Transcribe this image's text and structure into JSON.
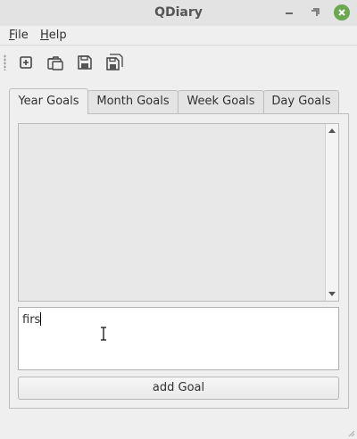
{
  "window": {
    "title": "QDiary",
    "controls": [
      "minimize-icon",
      "maximize-icon",
      "close-icon"
    ]
  },
  "menubar": {
    "items": [
      {
        "label": "File",
        "mnemonic": "F"
      },
      {
        "label": "Help",
        "mnemonic": "H"
      }
    ]
  },
  "toolbar": {
    "buttons": [
      "new-icon",
      "open-icon",
      "save-icon",
      "save-all-icon"
    ]
  },
  "tabs": [
    {
      "label": "Year Goals",
      "active": true
    },
    {
      "label": "Month Goals",
      "active": false
    },
    {
      "label": "Week Goals",
      "active": false
    },
    {
      "label": "Day Goals",
      "active": false
    }
  ],
  "goal_list": {
    "items": []
  },
  "goal_input": {
    "value": "firs"
  },
  "add_button": {
    "label": "add Goal"
  },
  "colors": {
    "close_button": "#6aa84f",
    "window_bg": "#efefef"
  }
}
